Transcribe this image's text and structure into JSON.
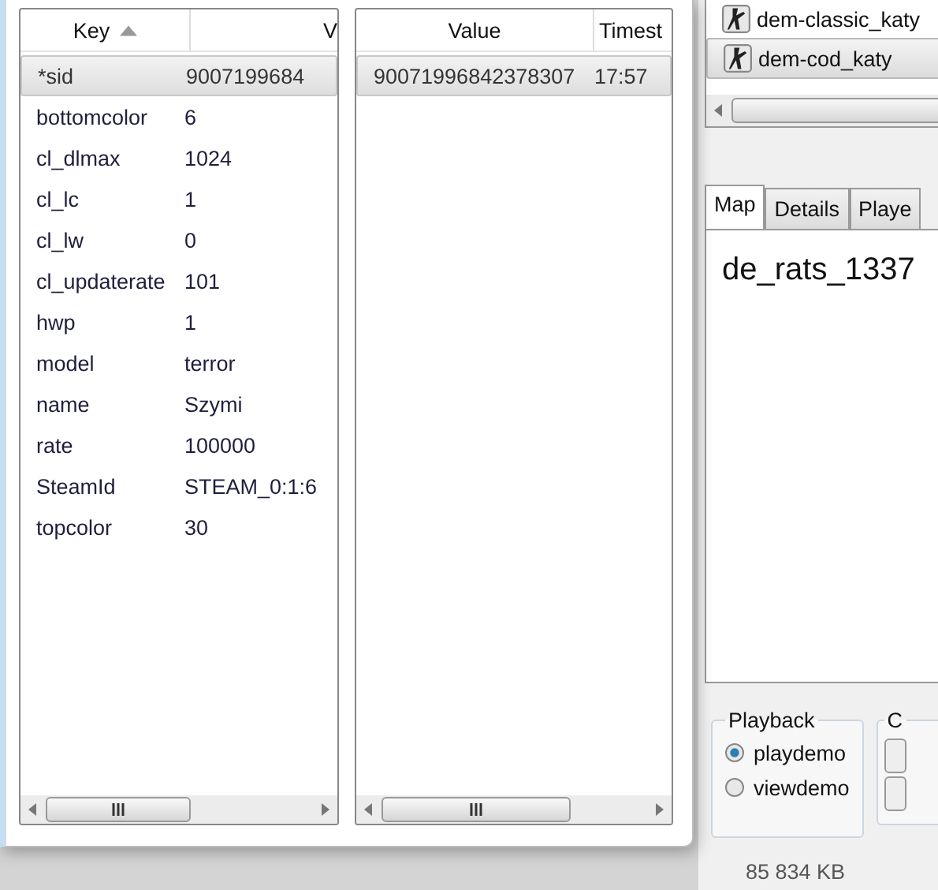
{
  "demo_list": {
    "items": [
      {
        "name": "dem-classic_katy",
        "selected": false
      },
      {
        "name": "dem-cod_katy",
        "selected": true
      }
    ]
  },
  "tabs": [
    {
      "label": "Map",
      "selected": true
    },
    {
      "label": "Details",
      "selected": false
    },
    {
      "label": "Playe",
      "selected": false
    }
  ],
  "map_name": "de_rats_1337",
  "playback": {
    "title": "Playback",
    "options": [
      {
        "label": "playdemo",
        "selected": true
      },
      {
        "label": "viewdemo",
        "selected": false
      }
    ]
  },
  "group_2_title": "C",
  "file_size": "85 834 KB",
  "key_table": {
    "columns": [
      {
        "label": "Key",
        "sorted": true
      },
      {
        "label": "V",
        "sorted": false
      }
    ],
    "rows": [
      {
        "key": "*sid",
        "value": "9007199684",
        "selected": true
      },
      {
        "key": "bottomcolor",
        "value": "6",
        "selected": false
      },
      {
        "key": "cl_dlmax",
        "value": "1024",
        "selected": false
      },
      {
        "key": "cl_lc",
        "value": "1",
        "selected": false
      },
      {
        "key": "cl_lw",
        "value": "0",
        "selected": false
      },
      {
        "key": "cl_updaterate",
        "value": "101",
        "selected": false
      },
      {
        "key": "hwp",
        "value": "1",
        "selected": false
      },
      {
        "key": "model",
        "value": "terror",
        "selected": false
      },
      {
        "key": "name",
        "value": "Szymi",
        "selected": false
      },
      {
        "key": "rate",
        "value": "100000",
        "selected": false
      },
      {
        "key": "SteamId",
        "value": "STEAM_0:1:6",
        "selected": false
      },
      {
        "key": "topcolor",
        "value": "30",
        "selected": false
      }
    ]
  },
  "value_table": {
    "columns": [
      {
        "label": "Value"
      },
      {
        "label": "Timest"
      }
    ],
    "rows": [
      {
        "value": "90071996842378307",
        "time": "17:57",
        "selected": true
      }
    ]
  }
}
